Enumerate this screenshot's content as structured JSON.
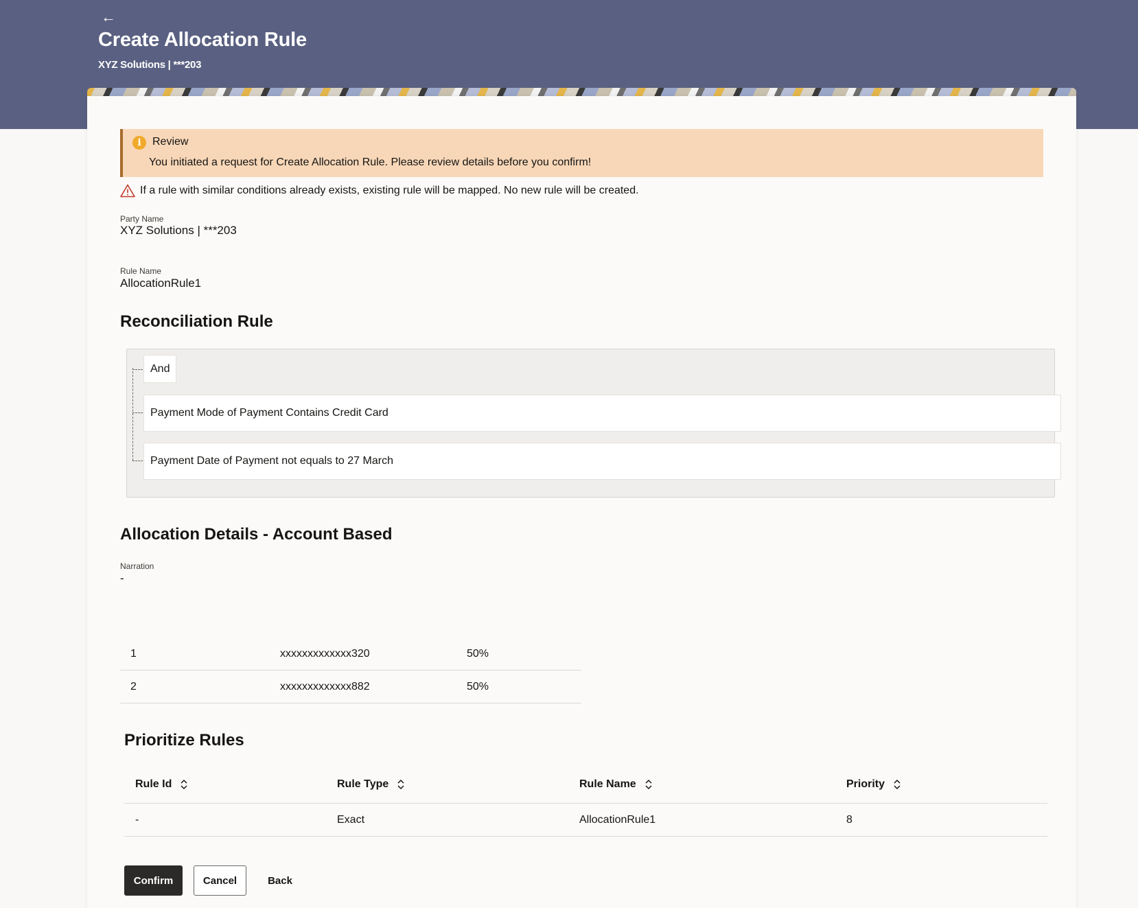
{
  "header": {
    "title": "Create Allocation Rule",
    "subtitle": "XYZ Solutions | ***203"
  },
  "review": {
    "title": "Review",
    "message": "You initiated a request for Create Allocation Rule. Please review details before you confirm!"
  },
  "warning": "If a rule with similar conditions already exists, existing rule will be mapped. No new rule will be created.",
  "fields": {
    "party_name_label": "Party Name",
    "party_name_value": "XYZ Solutions | ***203",
    "rule_name_label": "Rule Name",
    "rule_name_value": "AllocationRule1"
  },
  "reconciliation": {
    "title": "Reconciliation Rule",
    "operator": "And",
    "conditions": [
      "Payment Mode of Payment Contains Credit Card",
      "Payment Date of Payment not equals to 27 March"
    ]
  },
  "allocation": {
    "title": "Allocation Details - Account Based",
    "narration_label": "Narration",
    "narration_value": "-",
    "rows": [
      {
        "index": "1",
        "account": "xxxxxxxxxxxxx320",
        "percent": "50%"
      },
      {
        "index": "2",
        "account": "xxxxxxxxxxxxx882",
        "percent": "50%"
      }
    ]
  },
  "prioritize": {
    "title": "Prioritize Rules",
    "columns": [
      "Rule Id",
      "Rule Type",
      "Rule Name",
      "Priority"
    ],
    "rows": [
      {
        "rule_id": "-",
        "rule_type": "Exact",
        "rule_name": "AllocationRule1",
        "priority": "8"
      }
    ]
  },
  "actions": {
    "confirm": "Confirm",
    "cancel": "Cancel",
    "back": "Back"
  },
  "colors": {
    "header_band": "#5a6081",
    "review_bg": "#f8d7b8",
    "info_icon": "#f0a92b",
    "warning_icon": "#c0392b",
    "primary_button": "#2b2a28"
  },
  "icons": {
    "back": "arrow-left-icon",
    "review": "info-icon",
    "warning": "warning-triangle-icon",
    "sort": "sort-icon"
  }
}
